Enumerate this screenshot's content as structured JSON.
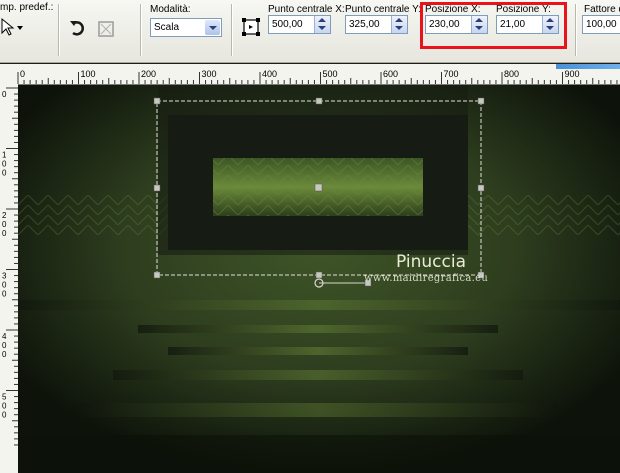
{
  "toolbar": {
    "preset_label": "mp. predef.:",
    "mode_label": "Modalità:",
    "mode_value": "Scala",
    "center_x_label": "Punto centrale X:",
    "center_x_value": "500,00",
    "center_y_label": "Punto centrale Y:",
    "center_y_value": "325,00",
    "pos_x_label": "Posizione X:",
    "pos_x_value": "230,00",
    "pos_y_label": "Posizione Y:",
    "pos_y_value": "21,00",
    "factor_label": "Fattore di",
    "factor_value": "100,00"
  },
  "ruler": {
    "h_labels": [
      "0",
      "100",
      "200",
      "300",
      "400",
      "500",
      "600",
      "700",
      "800",
      "900"
    ],
    "v_labels": [
      "0",
      "100",
      "200",
      "300",
      "400",
      "500"
    ]
  },
  "canvas": {
    "watermark_title": "Pinuccia",
    "watermark_url": "www.maidiregrafica.eu"
  },
  "colors": {
    "highlight": "#e8131b",
    "canvas_dark": "#1c2418",
    "canvas_green": "#4e6a2a"
  }
}
